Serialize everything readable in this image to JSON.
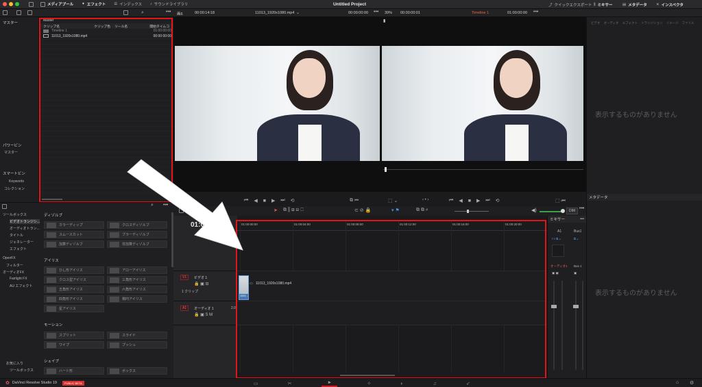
{
  "topbar": {
    "media_pool": "メディアプール",
    "effects": "エフェクト",
    "index": "インデックス",
    "sound_library": "サウンドライブラリ",
    "project_title": "Untitled Project",
    "quick_export": "クイックエクスポート",
    "mixer": "ミキサー",
    "metadata": "メタデータ",
    "inspector": "インスペクタ"
  },
  "toolbar2": {
    "fit_left": "画6",
    "tc_left": "00:00:14:18",
    "clip_name": "11013_1920x1080.mp4",
    "tc_left2": "00:00:00:00",
    "zoom_right": "39%",
    "tc_right": "00:00:00:01",
    "timeline_name": "Timeline 1",
    "tc_right2": "01:00:00:00"
  },
  "left_panel": {
    "master": "マスター",
    "power_bins": "パワービン",
    "power_bins_item": "マスター",
    "smart_bins": "スマートビン",
    "keywords": "Keywords",
    "collection": "コレクション"
  },
  "media_pool": {
    "bin_title": "Master",
    "col_clip_name": "クリップ名",
    "col_clip_color": "クリップ色",
    "col_reel": "リール名",
    "col_start_tc": "開始タイムコ",
    "rows": [
      {
        "name": "Timeline 1",
        "tc": "01:00:00:00"
      },
      {
        "name": "11013_1920x1080.mp4",
        "tc": "00:00:00:00"
      }
    ]
  },
  "inspector": {
    "tabs": [
      "ビデオ",
      "オーディオ",
      "エフェクト",
      "トランジション",
      "イメージ",
      "ファイル"
    ],
    "empty_msg": "表示するものがありません",
    "metadata_title": "メタデータ",
    "metadata_empty": "表示するものがありません"
  },
  "toolbox": {
    "tree": [
      {
        "label": "ツールボックス"
      },
      {
        "label": "ビデオトランジシ..."
      },
      {
        "label": "オーディオトラン..."
      },
      {
        "label": "タイトル"
      },
      {
        "label": "ジェネレーター"
      },
      {
        "label": "エフェクト"
      },
      {
        "label": "OpenFX"
      },
      {
        "label": "フィルター"
      },
      {
        "label": "オーディオFX"
      },
      {
        "label": "Fairlight FX"
      },
      {
        "label": "AU エフェクト"
      }
    ],
    "favorites": "お気に入り",
    "favorites_item": "ツールボックス"
  },
  "transitions": {
    "dissolve_title": "ディゾルブ",
    "dissolve": [
      "カラーディップ",
      "クロスディゾルブ",
      "スムースカット",
      "ブラーディゾルブ",
      "加算ディゾルブ",
      "非加算ディゾルブ"
    ],
    "iris_title": "アイリス",
    "iris": [
      "ひし形アイリス",
      "アローアイリス",
      "クロス型アイリス",
      "三角形アイリス",
      "五角形アイリス",
      "六角形アイリス",
      "四角形アイリス",
      "楕円アイリス",
      "星アイリス"
    ],
    "motion_title": "モーション",
    "motion": [
      "スプリット",
      "スライド",
      "ワイプ",
      "プッシュ"
    ],
    "shape_title": "シェイプ",
    "shape": [
      "ハート形",
      "ボックス"
    ]
  },
  "timeline": {
    "timecode": "01:00:00:00",
    "ruler": [
      "01:00:00:00",
      "01:00:04:00",
      "01:00:08:00",
      "01:00:12:00",
      "01:00:16:00",
      "01:00:20:00"
    ],
    "v1_label": "V1",
    "v1_name": "ビデオ 1",
    "v1_count": "1 クリップ",
    "a1_label": "A1",
    "a1_name": "オーディオ 1",
    "a1_value": "2.0",
    "clip_label": "11013_1920x1080.mp4",
    "clip_thumb_label": "1101...",
    "dim": "DIM"
  },
  "mixer": {
    "title": "ミキサー",
    "ch1": "A1",
    "ch2": "Bus1",
    "ch1_name": "オーディオ1",
    "ch2_name": "Bus 1"
  },
  "bottombar": {
    "app_name": "DaVinci Resolve Studio 19",
    "beta": "PUBLIC BETA"
  },
  "colors": {
    "highlight": "#e2141c",
    "accent_orange": "#e8644a",
    "clip_blue": "#4a78b0"
  }
}
